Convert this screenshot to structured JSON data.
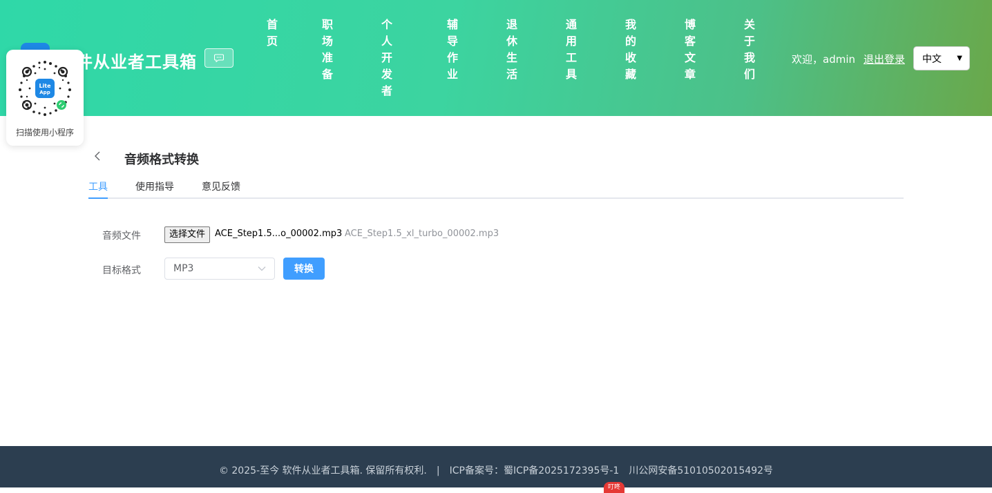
{
  "header": {
    "brand_title": "件从业者工具箱",
    "chat_icon": "chat-bubble-icon",
    "nav": [
      {
        "label": "首页"
      },
      {
        "label": "职场准备"
      },
      {
        "label": "个人开发者"
      },
      {
        "label": "辅导作业"
      },
      {
        "label": "退休生活"
      },
      {
        "label": "通用工具"
      },
      {
        "label": "我的收藏"
      },
      {
        "label": "博客文章"
      },
      {
        "label": "关于我们"
      }
    ],
    "welcome": "欢迎，admin",
    "logout": "退出登录",
    "language": "中文"
  },
  "qr_card": {
    "label": "扫描使用小程序",
    "logo_text_line1": "Lite",
    "logo_text_line2": "App"
  },
  "page": {
    "title": "音频格式转换",
    "tabs": [
      {
        "label": "工具",
        "active": true
      },
      {
        "label": "使用指导",
        "active": false
      },
      {
        "label": "意见反馈",
        "active": false
      }
    ],
    "form": {
      "file_label": "音频文件",
      "choose_file_button": "选择文件",
      "chosen_file": "ACE_Step1.5...o_00002.mp3",
      "file_hint": "ACE_Step1.5_xl_turbo_00002.mp3",
      "format_label": "目标格式",
      "format_value": "MP3",
      "convert_button": "转换"
    }
  },
  "footer": {
    "copyright": "© 2025-至今 软件从业者工具箱. 保留所有权利.",
    "separator": "|",
    "icp": "ICP备案号：蜀ICP备2025172395号-1",
    "police": "川公网安备51010502015492号"
  },
  "badge": "叮咚",
  "colors": {
    "accent": "#409eff",
    "header_start": "#2fd8a8",
    "header_end": "#6aa84a",
    "footer_bg": "#2c3e50"
  }
}
